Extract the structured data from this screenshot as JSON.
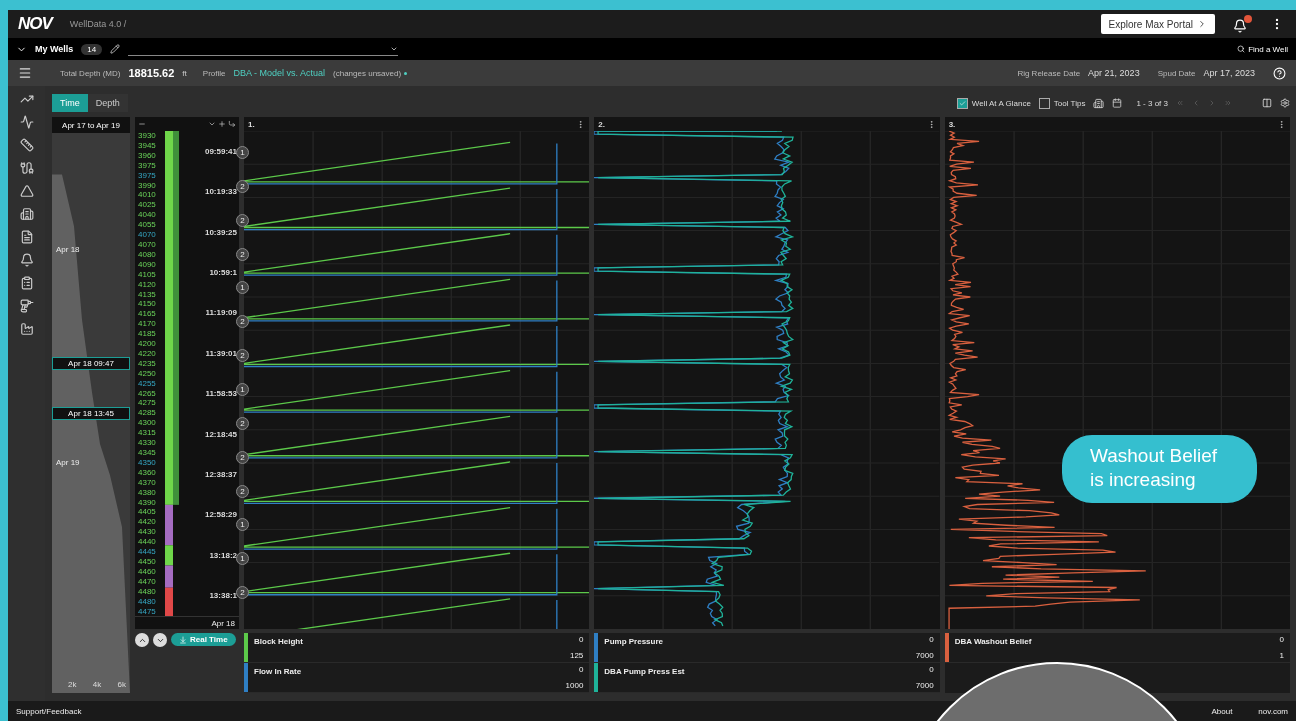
{
  "header": {
    "logo": "NOV",
    "breadcrumb": "WellData 4.0 /",
    "portal_button": "Explore Max Portal",
    "alert_badge": true
  },
  "wells_bar": {
    "label": "My Wells",
    "count": "14",
    "find": "Find a Well"
  },
  "info_bar": {
    "total_depth_label": "Total Depth (MD)",
    "total_depth": "18815.62",
    "unit": "ft",
    "profile_label": "Profile",
    "profile": "DBA - Model vs. Actual",
    "profile_status": "(changes unsaved)",
    "unsaved": true,
    "rig_release_label": "Rig Release Date",
    "rig_release": "Apr 21, 2023",
    "spud_label": "Spud Date",
    "spud": "Apr 17, 2023"
  },
  "view_tabs": [
    {
      "label": "Time",
      "selected": true
    },
    {
      "label": "Depth",
      "selected": false
    }
  ],
  "toolbar": {
    "options": [
      {
        "label": "Well At A Glance",
        "checked": true
      },
      {
        "label": "Tool Tips",
        "checked": false
      }
    ],
    "paging": "1 - 3 of 3"
  },
  "overview": {
    "range": "Apr 17 to Apr 19",
    "day_labels": [
      "Apr 18",
      "Apr 19"
    ],
    "handles": [
      "Apr 18 09:47",
      "Apr 18 13:45"
    ],
    "axis": [
      "2k",
      "4k",
      "6k"
    ]
  },
  "depth_track": {
    "depths": [
      {
        "label": "3930",
        "marker": false
      },
      {
        "label": "3945",
        "marker": false
      },
      {
        "label": "3960",
        "marker": false
      },
      {
        "label": "3975",
        "marker": false
      },
      {
        "label": "3975",
        "marker": true
      },
      {
        "label": "3990",
        "marker": false
      },
      {
        "label": "4010",
        "marker": false
      },
      {
        "label": "4025",
        "marker": false
      },
      {
        "label": "4040",
        "marker": false
      },
      {
        "label": "4055",
        "marker": false
      },
      {
        "label": "4070",
        "marker": true
      },
      {
        "label": "4070",
        "marker": false
      },
      {
        "label": "4080",
        "marker": false
      },
      {
        "label": "4090",
        "marker": false
      },
      {
        "label": "4105",
        "marker": false
      },
      {
        "label": "4120",
        "marker": false
      },
      {
        "label": "4135",
        "marker": false
      },
      {
        "label": "4150",
        "marker": false
      },
      {
        "label": "4165",
        "marker": false
      },
      {
        "label": "4170",
        "marker": false
      },
      {
        "label": "4185",
        "marker": false
      },
      {
        "label": "4200",
        "marker": false
      },
      {
        "label": "4220",
        "marker": false
      },
      {
        "label": "4235",
        "marker": false
      },
      {
        "label": "4250",
        "marker": false
      },
      {
        "label": "4255",
        "marker": true
      },
      {
        "label": "4265",
        "marker": false
      },
      {
        "label": "4275",
        "marker": false
      },
      {
        "label": "4285",
        "marker": false
      },
      {
        "label": "4300",
        "marker": false
      },
      {
        "label": "4315",
        "marker": false
      },
      {
        "label": "4330",
        "marker": false
      },
      {
        "label": "4345",
        "marker": false
      },
      {
        "label": "4350",
        "marker": true
      },
      {
        "label": "4360",
        "marker": false
      },
      {
        "label": "4370",
        "marker": false
      },
      {
        "label": "4380",
        "marker": false
      },
      {
        "label": "4390",
        "marker": false
      },
      {
        "label": "4405",
        "marker": false
      },
      {
        "label": "4420",
        "marker": false
      },
      {
        "label": "4430",
        "marker": false
      },
      {
        "label": "4440",
        "marker": false
      },
      {
        "label": "4445",
        "marker": true
      },
      {
        "label": "4450",
        "marker": false
      },
      {
        "label": "4460",
        "marker": false
      },
      {
        "label": "4470",
        "marker": false
      },
      {
        "label": "4480",
        "marker": false
      },
      {
        "label": "4480",
        "marker": true
      },
      {
        "label": "4475",
        "marker": true
      }
    ],
    "times": [
      "09:59:41",
      "10:19:33",
      "10:39:25",
      "10:59:1",
      "11:19:09",
      "11:39:01",
      "11:58:53",
      "12:18:45",
      "12:38:37",
      "12:58:29",
      "13:18:2",
      "13:38:1"
    ],
    "footer": "Apr 18"
  },
  "controls": {
    "real_time": "Real Time"
  },
  "panels": [
    {
      "title": "1.",
      "kind": "ramps",
      "markers": [
        "1",
        "2",
        "2",
        "2",
        "1",
        "2",
        "2",
        "1",
        "2",
        "2",
        "2",
        "1",
        "1",
        "2"
      ],
      "legend": [
        {
          "name": "Block Height",
          "color": "#5cc94a",
          "min": "0",
          "max": "125"
        },
        {
          "name": "Flow In Rate",
          "color": "#2f7fc4",
          "min": "0",
          "max": "1000"
        }
      ]
    },
    {
      "title": "2.",
      "kind": "pressure",
      "legend": [
        {
          "name": "Pump Pressure",
          "color": "#2f7fc4",
          "min": "0",
          "max": "7000"
        },
        {
          "name": "DBA Pump Press Est",
          "color": "#1fb39a",
          "min": "0",
          "max": "7000"
        }
      ]
    },
    {
      "title": "3.",
      "kind": "belief",
      "legend": [
        {
          "name": "DBA Washout Belief",
          "color": "#d9603f",
          "min": "0",
          "max": "1"
        }
      ]
    }
  ],
  "callout": "Washout Belief is increasing",
  "footer": {
    "left": "Support/Feedback",
    "links": [
      "About",
      "nov.com"
    ]
  }
}
